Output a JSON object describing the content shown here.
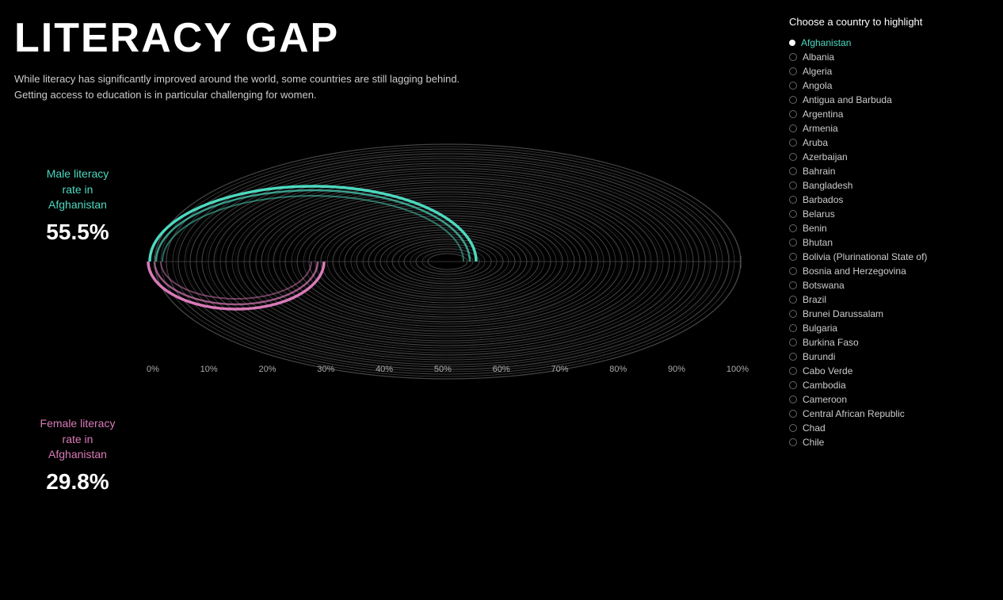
{
  "title": "LITERACY GAP",
  "subtitle": "While literacy has significantly improved around the world, some countries are still lagging behind.\nGetting access to education is in particular challenging for women.",
  "male_label": "Male literacy\nrate in\nAfghanistan",
  "male_rate": "55.5%",
  "female_label": "Female literacy\nrate in\nAfghanistan",
  "female_rate": "29.8%",
  "sidebar_title": "Choose a country to highlight",
  "axis": [
    "0%",
    "10%",
    "20%",
    "30%",
    "40%",
    "50%",
    "60%",
    "70%",
    "80%",
    "90%",
    "100%"
  ],
  "colors": {
    "male": "#4dd9c0",
    "female": "#d97ab8",
    "default": "#555",
    "bg": "#000"
  },
  "countries": [
    {
      "name": "Afghanistan",
      "highlighted": true
    },
    {
      "name": "Albania",
      "highlighted": false
    },
    {
      "name": "Algeria",
      "highlighted": false
    },
    {
      "name": "Angola",
      "highlighted": false
    },
    {
      "name": "Antigua and Barbuda",
      "highlighted": false
    },
    {
      "name": "Argentina",
      "highlighted": false
    },
    {
      "name": "Armenia",
      "highlighted": false
    },
    {
      "name": "Aruba",
      "highlighted": false
    },
    {
      "name": "Azerbaijan",
      "highlighted": false
    },
    {
      "name": "Bahrain",
      "highlighted": false
    },
    {
      "name": "Bangladesh",
      "highlighted": false
    },
    {
      "name": "Barbados",
      "highlighted": false
    },
    {
      "name": "Belarus",
      "highlighted": false
    },
    {
      "name": "Benin",
      "highlighted": false
    },
    {
      "name": "Bhutan",
      "highlighted": false
    },
    {
      "name": "Bolivia (Plurinational State of)",
      "highlighted": false
    },
    {
      "name": "Bosnia and Herzegovina",
      "highlighted": false
    },
    {
      "name": "Botswana",
      "highlighted": false
    },
    {
      "name": "Brazil",
      "highlighted": false
    },
    {
      "name": "Brunei Darussalam",
      "highlighted": false
    },
    {
      "name": "Bulgaria",
      "highlighted": false
    },
    {
      "name": "Burkina Faso",
      "highlighted": false
    },
    {
      "name": "Burundi",
      "highlighted": false
    },
    {
      "name": "Cabo Verde",
      "highlighted": false
    },
    {
      "name": "Cambodia",
      "highlighted": false
    },
    {
      "name": "Cameroon",
      "highlighted": false
    },
    {
      "name": "Central African Republic",
      "highlighted": false
    },
    {
      "name": "Chad",
      "highlighted": false
    },
    {
      "name": "Chile",
      "highlighted": false
    }
  ]
}
